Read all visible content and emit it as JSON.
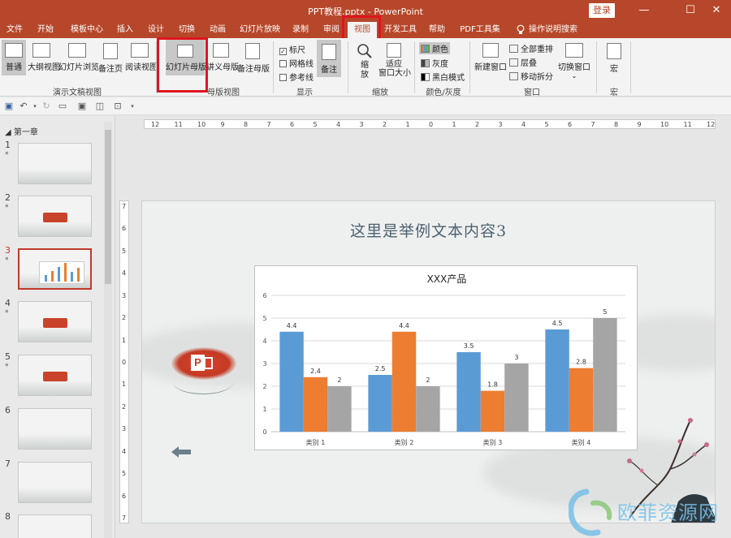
{
  "window": {
    "title": "PPT教程.pptx - PowerPoint",
    "login": "登录",
    "controls": [
      "—",
      "☐",
      "✕"
    ]
  },
  "tabs": [
    "文件",
    "开始",
    "模板中心",
    "插入",
    "设计",
    "切换",
    "动画",
    "幻灯片放映",
    "录制",
    "审阅",
    "视图",
    "开发工具",
    "帮助",
    "PDF工具集",
    "操作说明搜索"
  ],
  "active_tab": "视图",
  "ribbon": {
    "views": [
      "普通",
      "大纲视图",
      "幻灯片浏览",
      "备注页",
      "阅读视图"
    ],
    "group_views_label": "演示文稿视图",
    "master": [
      "幻灯片母版",
      "讲义母版",
      "备注母版"
    ],
    "group_master_label": "母版视图",
    "show": {
      "ruler": "标尺",
      "grid": "网格线",
      "guides": "参考线",
      "notes": "备注",
      "label": "显示"
    },
    "zoom": {
      "zoom": "缩放",
      "fit": "适应\n窗口大小",
      "label": "缩放"
    },
    "color": {
      "color": "颜色",
      "gray": "灰度",
      "bw": "黑白模式",
      "label": "颜色/灰度"
    },
    "window": {
      "new": "新建窗口",
      "arrange": "全部重排",
      "cascade": "层叠",
      "split": "移动拆分",
      "switch": "切换窗口",
      "label": "窗口"
    },
    "macro": {
      "macro": "宏",
      "label": "宏"
    },
    "colors": {
      "ruler_checked": true
    }
  },
  "thumbs": {
    "section": "第一章",
    "numbers": [
      "1",
      "2",
      "3",
      "4",
      "5",
      "6",
      "7",
      "8"
    ],
    "active": "3",
    "star": "*"
  },
  "ruler": {
    "h_ticks": [
      "12",
      "11",
      "10",
      "9",
      "8",
      "7",
      "6",
      "5",
      "4",
      "3",
      "2",
      "1",
      "0",
      "1",
      "2",
      "3",
      "4",
      "5",
      "6",
      "7",
      "8",
      "9",
      "10",
      "11",
      "12"
    ],
    "v_ticks": [
      "7",
      "6",
      "5",
      "4",
      "3",
      "2",
      "1",
      "0",
      "1",
      "2",
      "3",
      "4",
      "5",
      "6",
      "7"
    ]
  },
  "slide": {
    "title": "这里是举例文本内容3"
  },
  "chart_data": {
    "type": "bar",
    "title": "XXX产品",
    "categories": [
      "类别 1",
      "类别 2",
      "类别 3",
      "类别 4"
    ],
    "series": [
      {
        "values": [
          4.4,
          2.5,
          3.5,
          4.5
        ],
        "color": "#5b9bd5"
      },
      {
        "values": [
          2.4,
          4.4,
          1.8,
          2.8
        ],
        "color": "#ed7d31"
      },
      {
        "values": [
          2,
          2,
          3,
          5
        ],
        "color": "#a5a5a5"
      }
    ],
    "ylim": [
      0,
      6
    ],
    "yticks": [
      0,
      1,
      2,
      3,
      4,
      5,
      6
    ],
    "grid": true,
    "data_labels": true
  },
  "watermark": {
    "text": "欧菲资源网"
  },
  "colors": {
    "brand": "#b7472a",
    "highlight": "#e0141e"
  }
}
